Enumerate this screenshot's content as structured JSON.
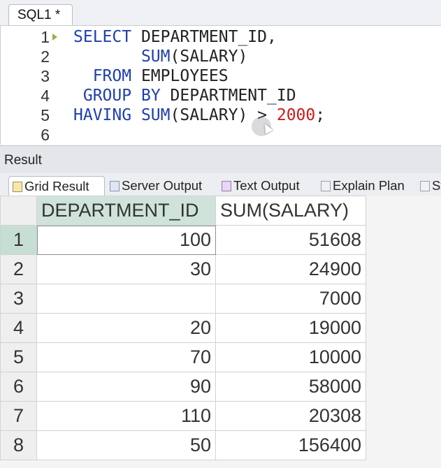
{
  "editor_tab": {
    "label": "SQL1 *"
  },
  "editor": {
    "lines": [
      {
        "num": "1",
        "tokens": [
          [
            "kw",
            "SELECT"
          ],
          [
            "pn",
            " "
          ],
          [
            "id",
            "DEPARTMENT_ID"
          ],
          [
            "pn",
            ","
          ]
        ]
      },
      {
        "num": "2",
        "tokens": [
          [
            "pn",
            "       "
          ],
          [
            "fn",
            "SUM"
          ],
          [
            "pn",
            "("
          ],
          [
            "id",
            "SALARY"
          ],
          [
            "pn",
            ")"
          ]
        ]
      },
      {
        "num": "3",
        "tokens": [
          [
            "pn",
            "  "
          ],
          [
            "kw",
            "FROM"
          ],
          [
            "pn",
            " "
          ],
          [
            "id",
            "EMPLOYEES"
          ]
        ]
      },
      {
        "num": "4",
        "tokens": [
          [
            "pn",
            " "
          ],
          [
            "kw",
            "GROUP"
          ],
          [
            "pn",
            " "
          ],
          [
            "kw",
            "BY"
          ],
          [
            "pn",
            " "
          ],
          [
            "id",
            "DEPARTMENT_ID"
          ]
        ]
      },
      {
        "num": "5",
        "tokens": [
          [
            "kw",
            "HAVING"
          ],
          [
            "pn",
            " "
          ],
          [
            "fn",
            "SUM"
          ],
          [
            "pn",
            "("
          ],
          [
            "id",
            "SALARY"
          ],
          [
            "pn",
            ")"
          ],
          [
            "pn",
            " > "
          ],
          [
            "num",
            "2000"
          ],
          [
            "pn",
            ";"
          ]
        ]
      },
      {
        "num": "6",
        "tokens": []
      }
    ]
  },
  "result_panel": {
    "title": "Result",
    "tabs": [
      {
        "label": "Grid Result",
        "icon": "grid-icon"
      },
      {
        "label": "Server Output",
        "icon": "server-icon"
      },
      {
        "label": "Text Output",
        "icon": "text-icon"
      },
      {
        "label": "Explain Plan",
        "icon": "plan-icon"
      },
      {
        "label": "St",
        "icon": "stats-icon"
      }
    ]
  },
  "grid": {
    "columns": [
      "DEPARTMENT_ID",
      "SUM(SALARY)"
    ],
    "rows": [
      {
        "n": "1",
        "cells": [
          "100",
          "51608"
        ]
      },
      {
        "n": "2",
        "cells": [
          "30",
          "24900"
        ]
      },
      {
        "n": "3",
        "cells": [
          "",
          "7000"
        ]
      },
      {
        "n": "4",
        "cells": [
          "20",
          "19000"
        ]
      },
      {
        "n": "5",
        "cells": [
          "70",
          "10000"
        ]
      },
      {
        "n": "6",
        "cells": [
          "90",
          "58000"
        ]
      },
      {
        "n": "7",
        "cells": [
          "110",
          "20308"
        ]
      },
      {
        "n": "8",
        "cells": [
          "50",
          "156400"
        ]
      }
    ]
  },
  "colors": {
    "keyword": "#1f3fb0",
    "number": "#d01818",
    "selected_header": "#cfe3da"
  }
}
